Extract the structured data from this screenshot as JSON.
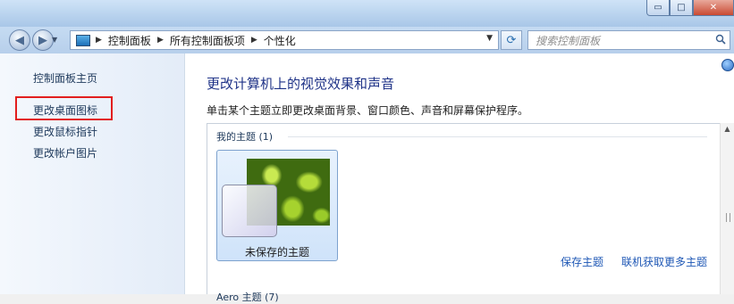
{
  "window": {
    "minimize_glyph": "▭",
    "maximize_glyph": "□",
    "close_glyph": "✕"
  },
  "nav": {
    "back_icon": "back-arrow-icon",
    "forward_icon": "forward-arrow-icon",
    "breadcrumbs": [
      "控制面板",
      "所有控制面板项",
      "个性化"
    ],
    "search_placeholder": "搜索控制面板"
  },
  "sidebar": {
    "items": [
      {
        "label": "控制面板主页",
        "highlighted": false
      },
      {
        "label": "更改桌面图标",
        "highlighted": true
      },
      {
        "label": "更改鼠标指针",
        "highlighted": false
      },
      {
        "label": "更改帐户图片",
        "highlighted": false
      }
    ],
    "highlight_color": "#e21e1e"
  },
  "main": {
    "title": "更改计算机上的视觉效果和声音",
    "description": "单击某个主题立即更改桌面背景、窗口颜色、声音和屏幕保护程序。",
    "my_themes_header": "我的主题 (1)",
    "selected_theme": "未保存的主题",
    "save_theme_link": "保存主题",
    "online_themes_link": "联机获取更多主题",
    "next_group_header": "Aero 主题 (7)"
  },
  "colors": {
    "title_blue": "#1e3287",
    "link_blue": "#1e57b5"
  }
}
